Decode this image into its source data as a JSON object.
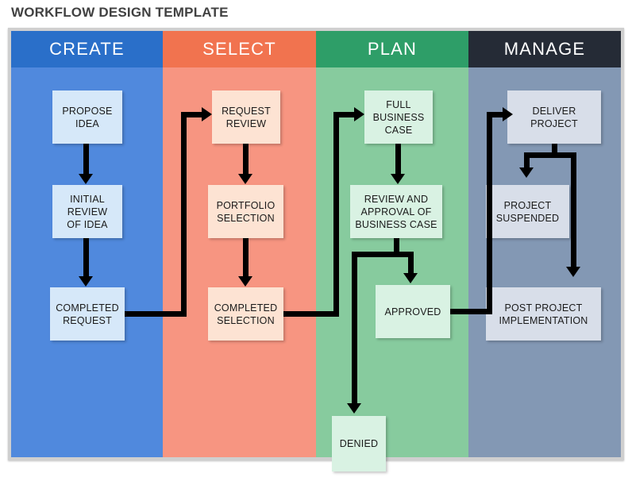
{
  "page": {
    "title": "WORKFLOW DESIGN TEMPLATE"
  },
  "colors": {
    "board_border": "#cfcfcf",
    "title_text": "#414141",
    "connector": "#000000",
    "create_header": "#2a6fc9",
    "create_body": "#5089dd",
    "create_node": "#d6e8f9",
    "select_header": "#f1734f",
    "select_body": "#f79581",
    "select_node": "#fde3d3",
    "plan_header": "#2e9e68",
    "plan_body": "#87cb9e",
    "plan_node": "#d9f2e3",
    "manage_header": "#252b36",
    "manage_body": "#8398b4",
    "manage_node": "#d8dee9"
  },
  "columns": [
    {
      "key": "create",
      "label": "CREATE",
      "nodes": [
        {
          "id": "propose-idea",
          "label": "PROPOSE\nIDEA"
        },
        {
          "id": "initial-review-of-idea",
          "label": "INITIAL\nREVIEW\nOF IDEA"
        },
        {
          "id": "completed-request",
          "label": "COMPLETED\nREQUEST"
        }
      ]
    },
    {
      "key": "select",
      "label": "SELECT",
      "nodes": [
        {
          "id": "request-review",
          "label": "REQUEST\nREVIEW"
        },
        {
          "id": "portfolio-selection",
          "label": "PORTFOLIO\nSELECTION"
        },
        {
          "id": "completed-selection",
          "label": "COMPLETED\nSELECTION"
        }
      ]
    },
    {
      "key": "plan",
      "label": "PLAN",
      "nodes": [
        {
          "id": "full-business-case",
          "label": "FULL\nBUSINESS\nCASE"
        },
        {
          "id": "review-and-approval-of-business-case",
          "label": "REVIEW AND\nAPPROVAL OF\nBUSINESS CASE"
        },
        {
          "id": "approved",
          "label": "APPROVED"
        },
        {
          "id": "denied",
          "label": "DENIED"
        }
      ]
    },
    {
      "key": "manage",
      "label": "MANAGE",
      "nodes": [
        {
          "id": "deliver-project",
          "label": "DELIVER\nPROJECT"
        },
        {
          "id": "project-suspended",
          "label": "PROJECT\nSUSPENDED"
        },
        {
          "id": "post-project-implementation",
          "label": "POST PROJECT\nIMPLEMENTATION"
        }
      ]
    }
  ],
  "flow": {
    "edges": [
      {
        "from": "propose-idea",
        "to": "initial-review-of-idea"
      },
      {
        "from": "initial-review-of-idea",
        "to": "completed-request"
      },
      {
        "from": "completed-request",
        "to": "request-review"
      },
      {
        "from": "request-review",
        "to": "portfolio-selection"
      },
      {
        "from": "portfolio-selection",
        "to": "completed-selection"
      },
      {
        "from": "completed-selection",
        "to": "full-business-case"
      },
      {
        "from": "full-business-case",
        "to": "review-and-approval-of-business-case"
      },
      {
        "from": "review-and-approval-of-business-case",
        "to": "approved"
      },
      {
        "from": "review-and-approval-of-business-case",
        "to": "denied"
      },
      {
        "from": "approved",
        "to": "deliver-project"
      },
      {
        "from": "deliver-project",
        "to": "project-suspended"
      },
      {
        "from": "deliver-project",
        "to": "post-project-implementation"
      }
    ]
  }
}
